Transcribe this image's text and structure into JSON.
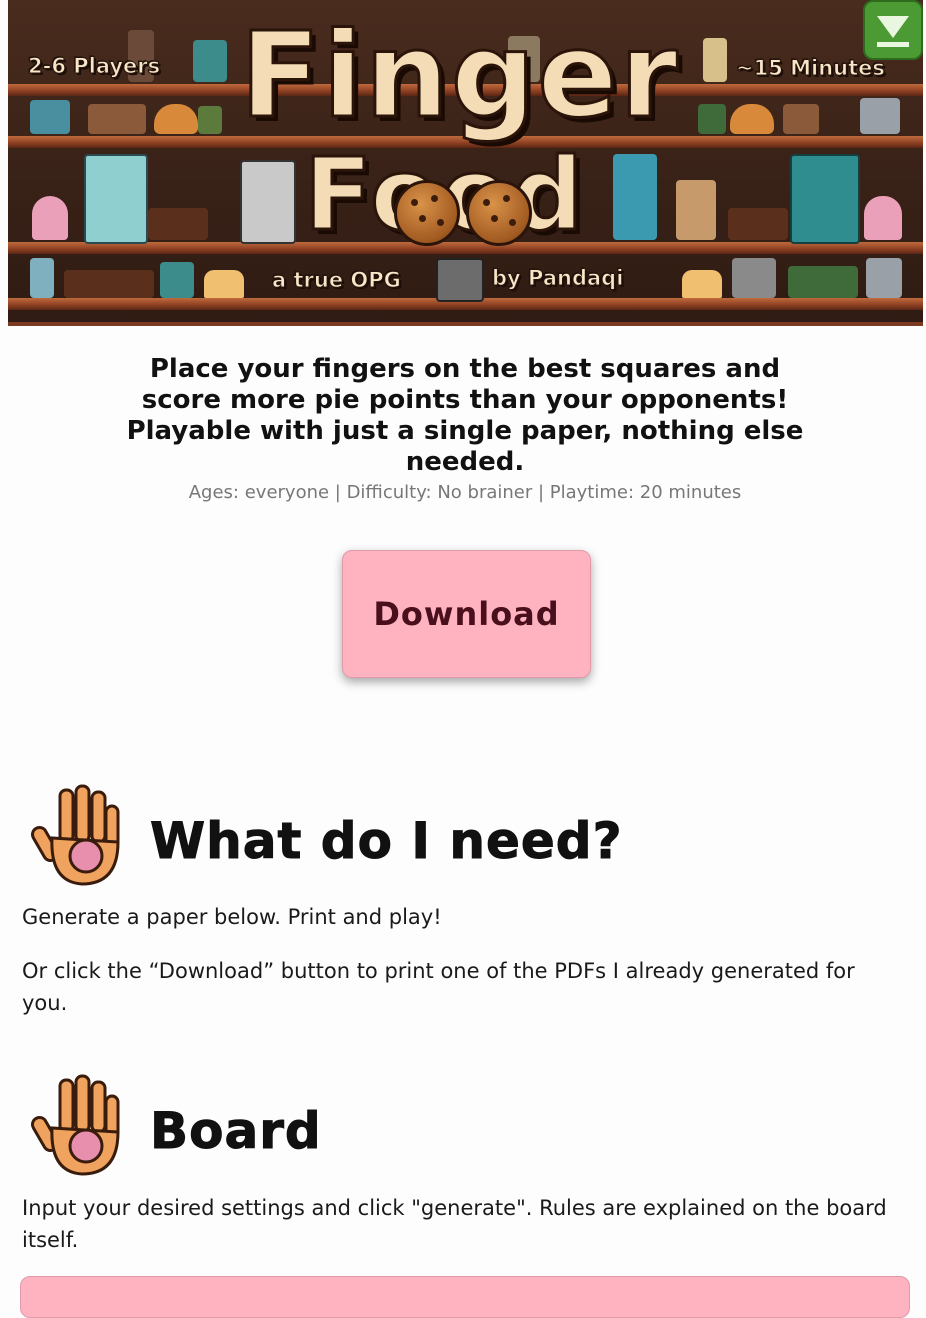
{
  "banner": {
    "title_line1": "Finger",
    "title_line2": "Food",
    "players": "2-6 Players",
    "duration": "~15 Minutes",
    "subtitle_left": "a true OPG",
    "subtitle_right": "by Pandaqi",
    "download_icon": "download-arrow-icon"
  },
  "intro": {
    "tagline": "Place your fingers on the best squares and score more pie points than your opponents! Playable with just a single paper, nothing else needed.",
    "meta": "Ages: everyone | Difficulty: No brainer | Playtime: 20 minutes",
    "download_label": "Download"
  },
  "sections": {
    "need": {
      "icon": "hand-icon",
      "heading": "What do I need?",
      "p1": "Generate a paper below. Print and play!",
      "p2": "Or click the “Download” button to print one of the PDFs I already generated for you."
    },
    "board": {
      "icon": "hand-icon",
      "heading": "Board",
      "p1": "Input your desired settings and click \"generate\". Rules are explained on the board itself."
    }
  },
  "colors": {
    "accent_pink": "#ffb3c1",
    "button_text": "#4a0f1c",
    "banner_wood": "#8b3f22"
  }
}
